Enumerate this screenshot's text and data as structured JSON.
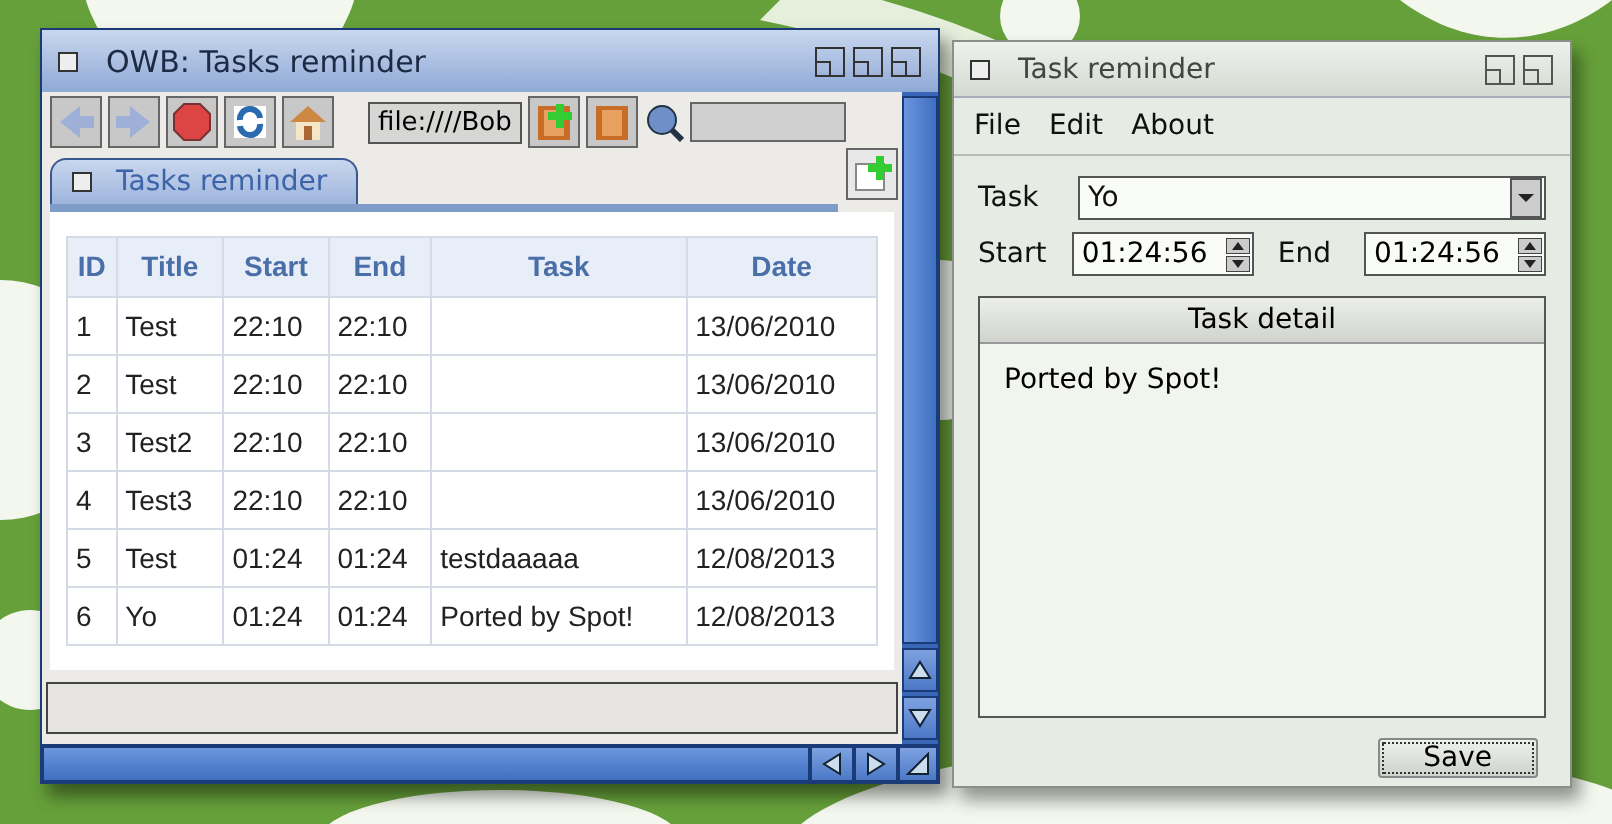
{
  "browser_window": {
    "title": "OWB: Tasks reminder",
    "address": "file:////Bob",
    "tabs": [
      {
        "label": "Tasks reminder",
        "selected": true
      }
    ],
    "table": {
      "columns": [
        "ID",
        "Title",
        "Start",
        "End",
        "Task",
        "Date"
      ],
      "rows": [
        [
          "1",
          "Test",
          "22:10",
          "22:10",
          "",
          "13/06/2010"
        ],
        [
          "2",
          "Test",
          "22:10",
          "22:10",
          "",
          "13/06/2010"
        ],
        [
          "3",
          "Test2",
          "22:10",
          "22:10",
          "",
          "13/06/2010"
        ],
        [
          "4",
          "Test3",
          "22:10",
          "22:10",
          "",
          "13/06/2010"
        ],
        [
          "5",
          "Test",
          "01:24",
          "01:24",
          "testdaaaaa",
          "12/08/2013"
        ],
        [
          "6",
          "Yo",
          "01:24",
          "01:24",
          "Ported by Spot!",
          "12/08/2013"
        ]
      ]
    }
  },
  "app_window": {
    "title": "Task reminder",
    "menu": [
      "File",
      "Edit",
      "About"
    ],
    "task_label": "Task",
    "task_value": "Yo",
    "start_label": "Start",
    "start_value": "01:24:56",
    "end_label": "End",
    "end_value": "01:24:56",
    "detail_title": "Task detail",
    "detail_text": "Ported by Spot!",
    "save_button": "Save"
  }
}
